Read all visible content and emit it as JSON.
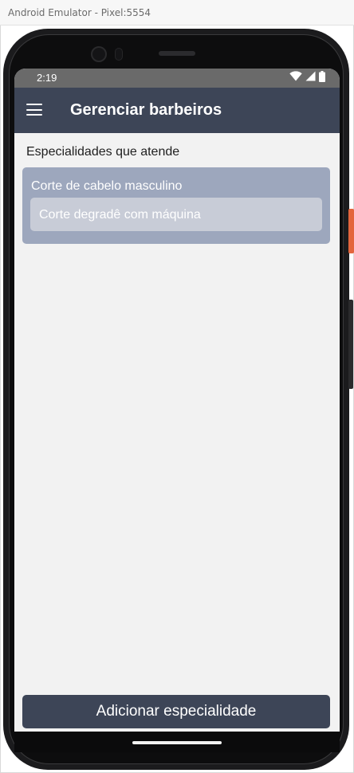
{
  "window": {
    "title": "Android Emulator - Pixel:5554"
  },
  "status_bar": {
    "time": "2:19",
    "icons": [
      "wifi-icon",
      "cell-signal-icon",
      "battery-icon"
    ]
  },
  "app_bar": {
    "menu_icon": "hamburger-menu-icon",
    "title": "Gerenciar barbeiros"
  },
  "main": {
    "section_label": "Especialidades que atende",
    "specialties": [
      {
        "category": "Corte de cabelo masculino",
        "service": "Corte degradê com máquina"
      }
    ],
    "add_button_label": "Adicionar especialidade"
  },
  "colors": {
    "app_bar": "#3d4557",
    "card": "#9da7bd",
    "chip": "#c8ccd7",
    "background": "#f2f2f2",
    "status_bar": "#6a6a6a"
  }
}
